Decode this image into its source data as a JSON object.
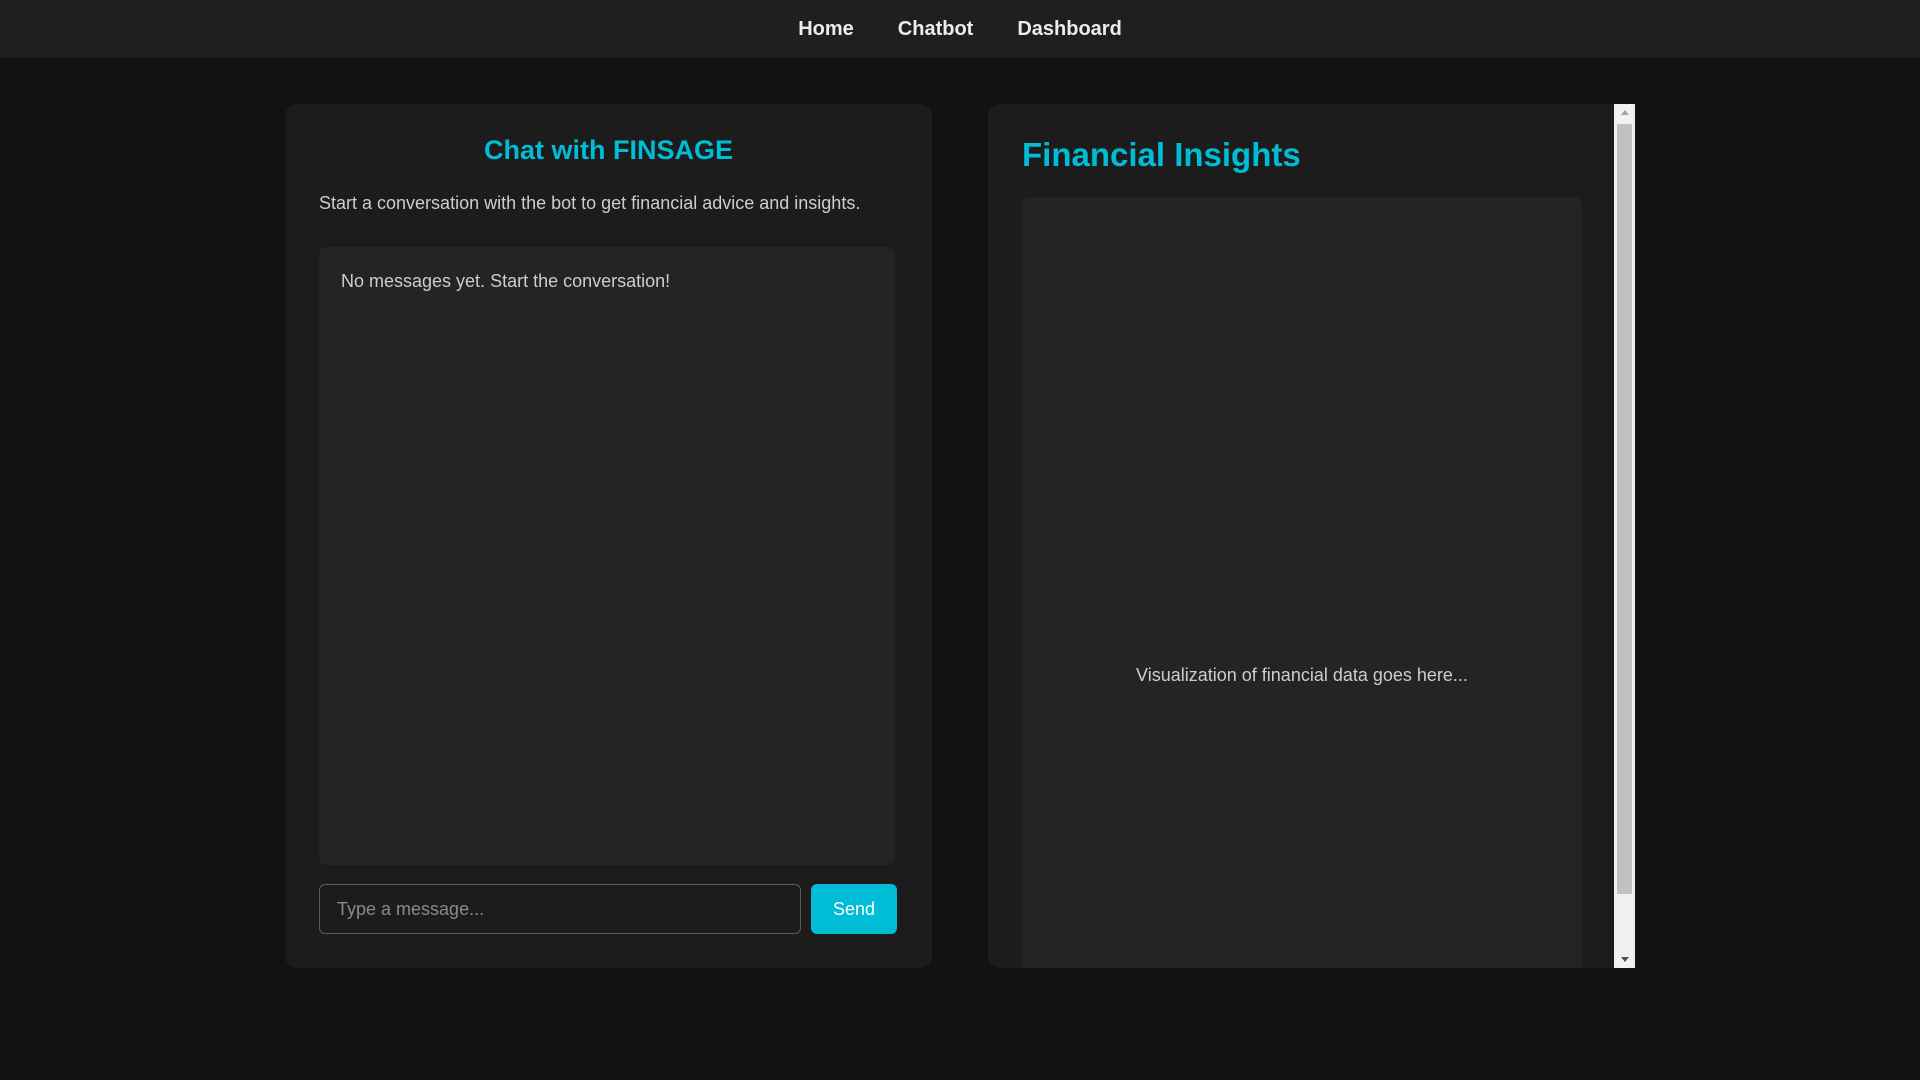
{
  "nav": {
    "items": [
      {
        "label": "Home"
      },
      {
        "label": "Chatbot"
      },
      {
        "label": "Dashboard"
      }
    ]
  },
  "chat": {
    "title": "Chat with FINSAGE",
    "subtitle": "Start a conversation with the bot to get financial advice and insights.",
    "empty_message": "No messages yet. Start the conversation!",
    "input": {
      "value": "",
      "placeholder": "Type a message..."
    },
    "send_label": "Send"
  },
  "insights": {
    "title": "Financial Insights",
    "placeholder_text": "Visualization of financial data goes here..."
  },
  "colors": {
    "accent": "#00bcd4",
    "background": "#121212",
    "panel": "#1c1c1c",
    "navbar": "#1f1f1f"
  },
  "icons": {
    "scroll_up": "triangle-up-icon",
    "scroll_down": "triangle-down-icon"
  }
}
